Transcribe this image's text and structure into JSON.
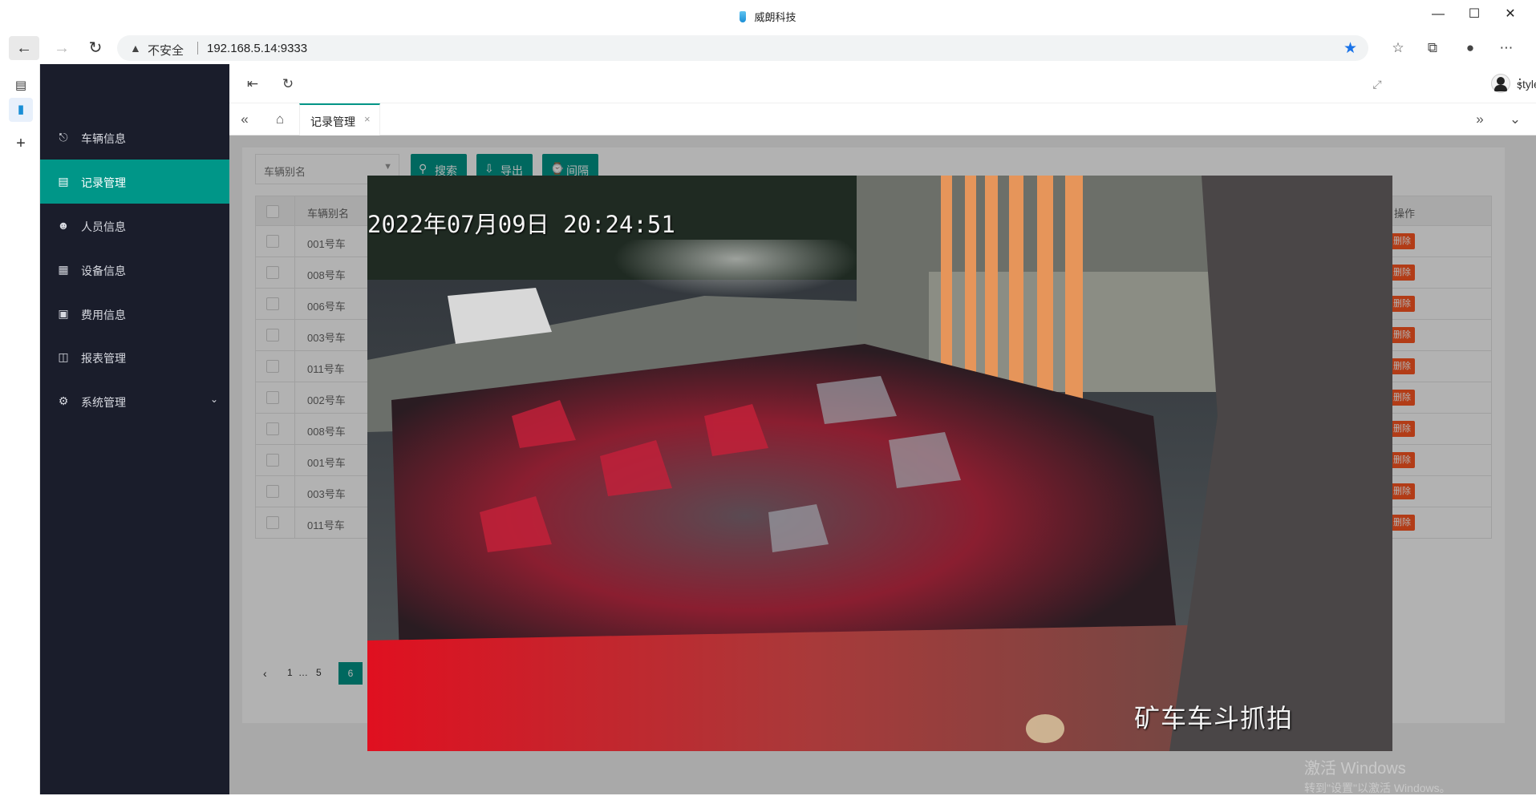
{
  "browser": {
    "tab_title": "威朗科技",
    "security_label": "不安全",
    "url": "192.168.5.14:9333"
  },
  "sidebar": {
    "items": [
      {
        "label": "车辆信息",
        "icon": "car-icon"
      },
      {
        "label": "记录管理",
        "icon": "document-icon"
      },
      {
        "label": "人员信息",
        "icon": "user-icon"
      },
      {
        "label": "设备信息",
        "icon": "device-icon"
      },
      {
        "label": "费用信息",
        "icon": "wallet-icon"
      },
      {
        "label": "报表管理",
        "icon": "report-icon"
      },
      {
        "label": "系统管理",
        "icon": "gear-icon"
      }
    ],
    "active": "记录管理"
  },
  "header": {
    "username": "stylefeng"
  },
  "tabs": {
    "active_label": "记录管理",
    "close_glyph": "×"
  },
  "toolbar": {
    "select_placeholder": "车辆别名",
    "search_label": "搜索",
    "export_label": "导出",
    "interval_label": "间隔"
  },
  "table": {
    "columns": [
      "车辆别名",
      "操作"
    ],
    "rows": [
      "001号车",
      "008号车",
      "006号车",
      "003号车",
      "011号车",
      "002号车",
      "008号车",
      "001号车",
      "003号车",
      "011号车"
    ],
    "delete_label": "删除"
  },
  "pager": {
    "first": "1",
    "ellipsis": "…",
    "prev_page": "5",
    "current": "6"
  },
  "modal": {
    "osd_timestamp": "2022年07月09日 20:24:51",
    "caption": "矿车车斗抓拍"
  },
  "watermark": {
    "line1": "激活 Windows",
    "line2": "转到\"设置\"以激活 Windows。"
  },
  "colors": {
    "accent": "#009688",
    "sidebar_bg": "#1a1d2b",
    "danger": "#ff5722"
  }
}
